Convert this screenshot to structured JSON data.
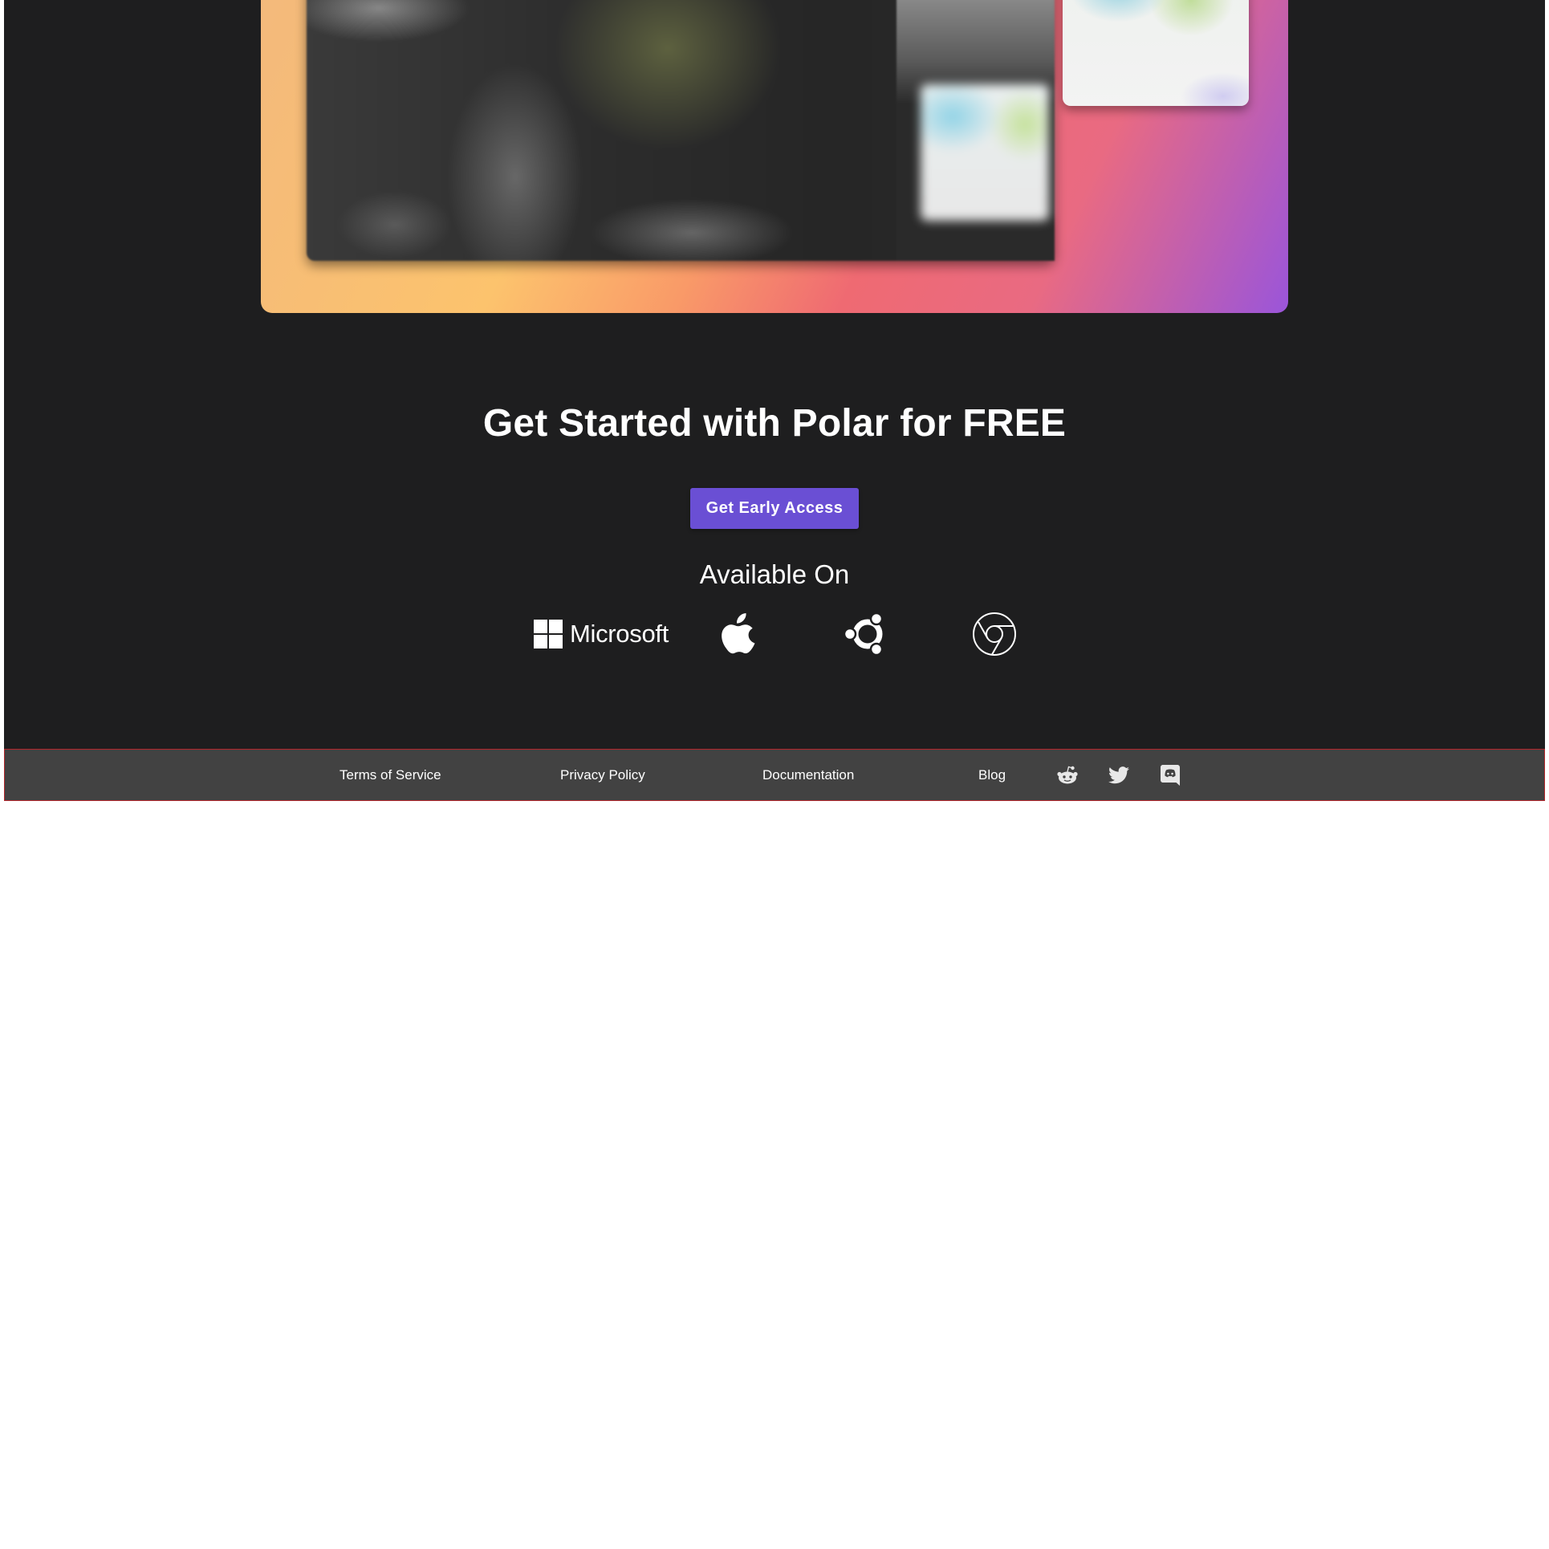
{
  "hero": {
    "gradient_colors": [
      "#f3b97c",
      "#fcc36d",
      "#f99a68",
      "#ef6a72",
      "#e96a82",
      "#9a55da"
    ]
  },
  "cta": {
    "title": "Get Started with Polar for FREE",
    "button_label": "Get Early Access",
    "button_color": "#6a4fd4"
  },
  "availability": {
    "label": "Available On",
    "platforms": [
      {
        "name": "Microsoft",
        "icon": "microsoft-logo-icon",
        "text": "Microsoft"
      },
      {
        "name": "Apple",
        "icon": "apple-logo-icon"
      },
      {
        "name": "Ubuntu",
        "icon": "ubuntu-logo-icon"
      },
      {
        "name": "Chrome",
        "icon": "chrome-logo-icon"
      }
    ]
  },
  "footer": {
    "links": [
      {
        "label": "Terms of Service"
      },
      {
        "label": "Privacy Policy"
      },
      {
        "label": "Documentation"
      },
      {
        "label": "Blog"
      }
    ],
    "social": [
      {
        "icon": "reddit-icon"
      },
      {
        "icon": "twitter-icon"
      },
      {
        "icon": "discord-icon"
      }
    ],
    "background": "#424242",
    "border_color": "#b3262c"
  },
  "colors": {
    "page_dark": "#1e1e1f",
    "page_light": "#ffffff"
  }
}
